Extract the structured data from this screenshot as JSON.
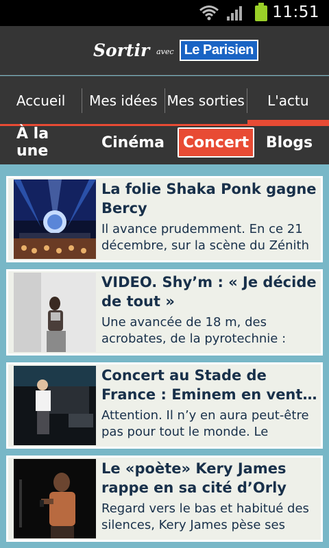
{
  "status_bar": {
    "time": "11:51",
    "icons": [
      "wifi-icon",
      "signal-icon",
      "battery-icon"
    ]
  },
  "header": {
    "brand_sortir": "Sortir",
    "brand_avec": "avec",
    "brand_parisien": "Le Parisien"
  },
  "main_nav": {
    "items": [
      {
        "label": "Accueil"
      },
      {
        "label": "Mes idées"
      },
      {
        "label": "Mes sorties"
      },
      {
        "label": "L'actu"
      }
    ],
    "active_index": 3
  },
  "sub_nav": {
    "tabs": [
      {
        "label": "À la une"
      },
      {
        "label": "Cinéma"
      },
      {
        "label": "Concert"
      },
      {
        "label": "Blogs"
      }
    ],
    "active_index": 2
  },
  "articles": [
    {
      "title_line1": "La folie Shaka Ponk gagne",
      "title_line2": "Bercy",
      "desc_line1": "Il avance prudemment. En ce 21",
      "desc_line2": "décembre, sur la scène du Zénith"
    },
    {
      "title_line1": "VIDEO. Shy’m : « Je décide",
      "title_line2": "de tout »",
      "desc_line1": "Une avancée de 18 m, des",
      "desc_line2": "acrobates, de la pyrotechnie :"
    },
    {
      "title_line1": "Concert au Stade de",
      "title_line2": "France : Eminem en vente…",
      "desc_line1": "Attention. Il n’y en aura peut-être",
      "desc_line2": "pas pour tout le monde. Le"
    },
    {
      "title_line1": "Le «poète» Kery James",
      "title_line2": "rappe en sa cité d’Orly",
      "desc_line1": "Regard vers le bas et habitué des",
      "desc_line2": "silences, Kery James pèse ses"
    }
  ],
  "colors": {
    "accent": "#e84b34",
    "background": "#78b7c7",
    "bar": "#363636",
    "card": "#eef0e9",
    "text": "#18304a"
  }
}
